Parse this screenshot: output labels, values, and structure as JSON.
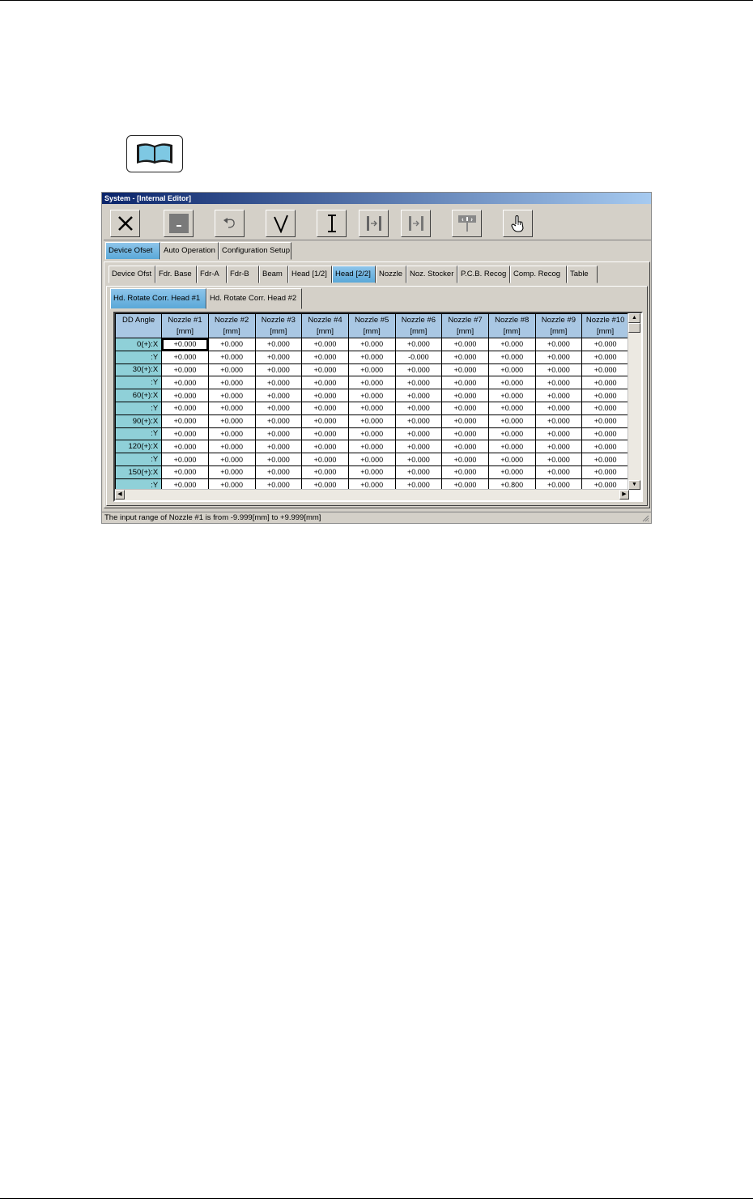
{
  "window": {
    "title": "System - [Internal Editor]"
  },
  "main_tabs": [
    {
      "label": "Device Ofset",
      "active": true
    },
    {
      "label": "Auto Operation",
      "active": false
    },
    {
      "label": "Configuration Setup",
      "active": false
    }
  ],
  "sub_tabs": [
    {
      "label": "Device Ofst",
      "active": false
    },
    {
      "label": "Fdr. Base",
      "active": false
    },
    {
      "label": "Fdr-A",
      "active": false
    },
    {
      "label": "Fdr-B",
      "active": false
    },
    {
      "label": "Beam",
      "active": false
    },
    {
      "label": "Head [1/2]",
      "active": false
    },
    {
      "label": "Head [2/2]",
      "active": true
    },
    {
      "label": "Nozzle",
      "active": false
    },
    {
      "label": "Noz. Stocker",
      "active": false
    },
    {
      "label": "P.C.B. Recog",
      "active": false
    },
    {
      "label": "Comp. Recog",
      "active": false
    },
    {
      "label": "Table",
      "active": false
    }
  ],
  "head_tabs": [
    {
      "label": "Hd. Rotate Corr. Head #1",
      "active": true
    },
    {
      "label": "Hd. Rotate Corr. Head #2",
      "active": false
    }
  ],
  "grid": {
    "corner": "DD Angle",
    "unit": "[mm]",
    "columns": [
      "Nozzle #1",
      "Nozzle #2",
      "Nozzle #3",
      "Nozzle #4",
      "Nozzle #5",
      "Nozzle #6",
      "Nozzle #7",
      "Nozzle #8",
      "Nozzle #9",
      "Nozzle #10"
    ],
    "rows": [
      {
        "label": "0(+):X",
        "values": [
          "+0.000",
          "+0.000",
          "+0.000",
          "+0.000",
          "+0.000",
          "+0.000",
          "+0.000",
          "+0.000",
          "+0.000",
          "+0.000"
        ]
      },
      {
        "label": ":Y",
        "values": [
          "+0.000",
          "+0.000",
          "+0.000",
          "+0.000",
          "+0.000",
          "-0.000",
          "+0.000",
          "+0.000",
          "+0.000",
          "+0.000"
        ]
      },
      {
        "label": "30(+):X",
        "values": [
          "+0.000",
          "+0.000",
          "+0.000",
          "+0.000",
          "+0.000",
          "+0.000",
          "+0.000",
          "+0.000",
          "+0.000",
          "+0.000"
        ]
      },
      {
        "label": ":Y",
        "values": [
          "+0.000",
          "+0.000",
          "+0.000",
          "+0.000",
          "+0.000",
          "+0.000",
          "+0.000",
          "+0.000",
          "+0.000",
          "+0.000"
        ]
      },
      {
        "label": "60(+):X",
        "values": [
          "+0.000",
          "+0.000",
          "+0.000",
          "+0.000",
          "+0.000",
          "+0.000",
          "+0.000",
          "+0.000",
          "+0.000",
          "+0.000"
        ]
      },
      {
        "label": ":Y",
        "values": [
          "+0.000",
          "+0.000",
          "+0.000",
          "+0.000",
          "+0.000",
          "+0.000",
          "+0.000",
          "+0.000",
          "+0.000",
          "+0.000"
        ]
      },
      {
        "label": "90(+):X",
        "values": [
          "+0.000",
          "+0.000",
          "+0.000",
          "+0.000",
          "+0.000",
          "+0.000",
          "+0.000",
          "+0.000",
          "+0.000",
          "+0.000"
        ]
      },
      {
        "label": ":Y",
        "values": [
          "+0.000",
          "+0.000",
          "+0.000",
          "+0.000",
          "+0.000",
          "+0.000",
          "+0.000",
          "+0.000",
          "+0.000",
          "+0.000"
        ]
      },
      {
        "label": "120(+):X",
        "values": [
          "+0.000",
          "+0.000",
          "+0.000",
          "+0.000",
          "+0.000",
          "+0.000",
          "+0.000",
          "+0.000",
          "+0.000",
          "+0.000"
        ]
      },
      {
        "label": ":Y",
        "values": [
          "+0.000",
          "+0.000",
          "+0.000",
          "+0.000",
          "+0.000",
          "+0.000",
          "+0.000",
          "+0.000",
          "+0.000",
          "+0.000"
        ]
      },
      {
        "label": "150(+):X",
        "values": [
          "+0.000",
          "+0.000",
          "+0.000",
          "+0.000",
          "+0.000",
          "+0.000",
          "+0.000",
          "+0.000",
          "+0.000",
          "+0.000"
        ]
      },
      {
        "label": ":Y",
        "values": [
          "+0.000",
          "+0.000",
          "+0.000",
          "+0.000",
          "+0.000",
          "+0.000",
          "+0.000",
          "+0.800",
          "+0.000",
          "+0.000"
        ]
      }
    ]
  },
  "status": {
    "text": "The input range of Nozzle #1  is from  -9.999[mm]  to  +9.999[mm]"
  },
  "colors": {
    "active_tab": "#5aa8d8",
    "column_header": "#a9c7e3",
    "row_header": "#8fd0d8",
    "titlebar": "#0a246a"
  },
  "icons": [
    "book-icon",
    "close-x-icon",
    "minimize-icon",
    "undo-icon",
    "checkmark-icon",
    "text-cursor-icon",
    "jump-icon",
    "jump-disabled-icon",
    "signal-icon",
    "hand-pointer-icon",
    "scroll-up-icon",
    "scroll-down-icon",
    "scroll-left-icon",
    "scroll-right-icon",
    "resize-grip-icon"
  ]
}
